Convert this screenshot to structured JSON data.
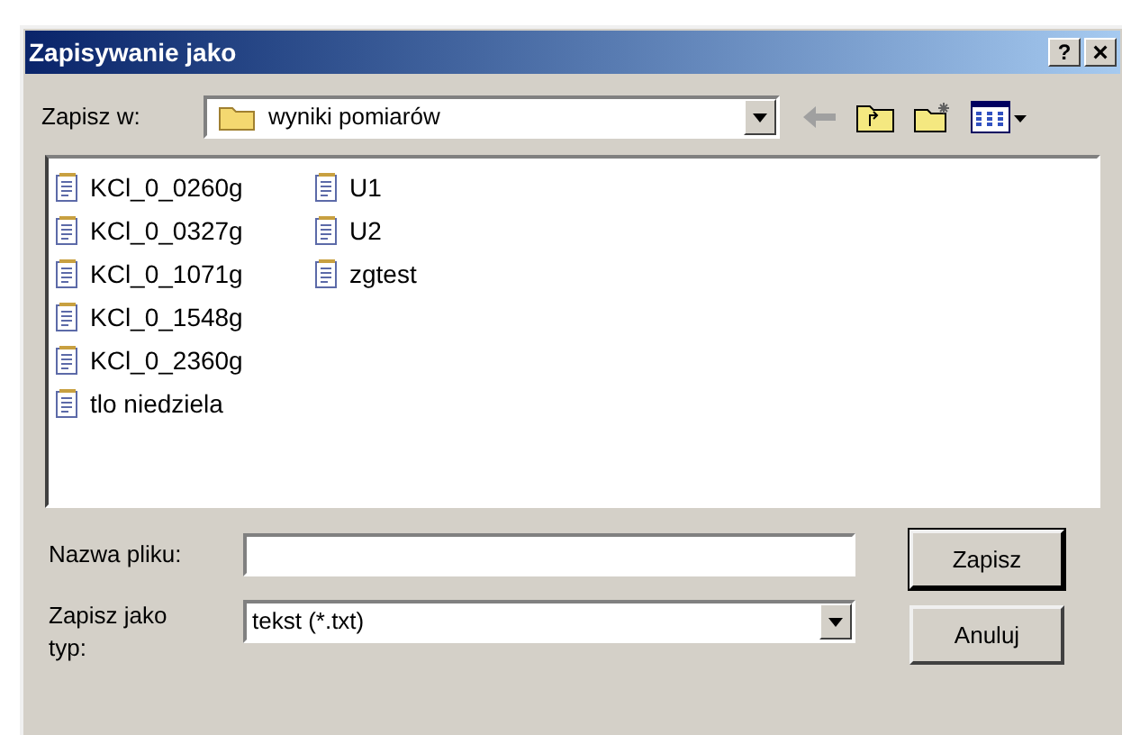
{
  "window": {
    "title": "Zapisywanie jako",
    "help_button": "?",
    "close_button": "×"
  },
  "location": {
    "label": "Zapisz w:",
    "value": "wyniki pomiarów"
  },
  "files": [
    {
      "name": "KCl_0_0260g"
    },
    {
      "name": "KCl_0_0327g"
    },
    {
      "name": "KCl_0_1071g"
    },
    {
      "name": "KCl_0_1548g"
    },
    {
      "name": "KCl_0_2360g"
    },
    {
      "name": "tlo niedziela"
    },
    {
      "name": "U1"
    },
    {
      "name": "U2"
    },
    {
      "name": "zgtest"
    }
  ],
  "file_name": {
    "label": "Nazwa pliku:"
  },
  "file_type": {
    "label": "Zapisz jako typ:",
    "value": "tekst (*.txt)"
  },
  "buttons": [
    {
      "label": "Zapisz",
      "default": true
    },
    {
      "label": "Anuluj",
      "default": false
    }
  ]
}
